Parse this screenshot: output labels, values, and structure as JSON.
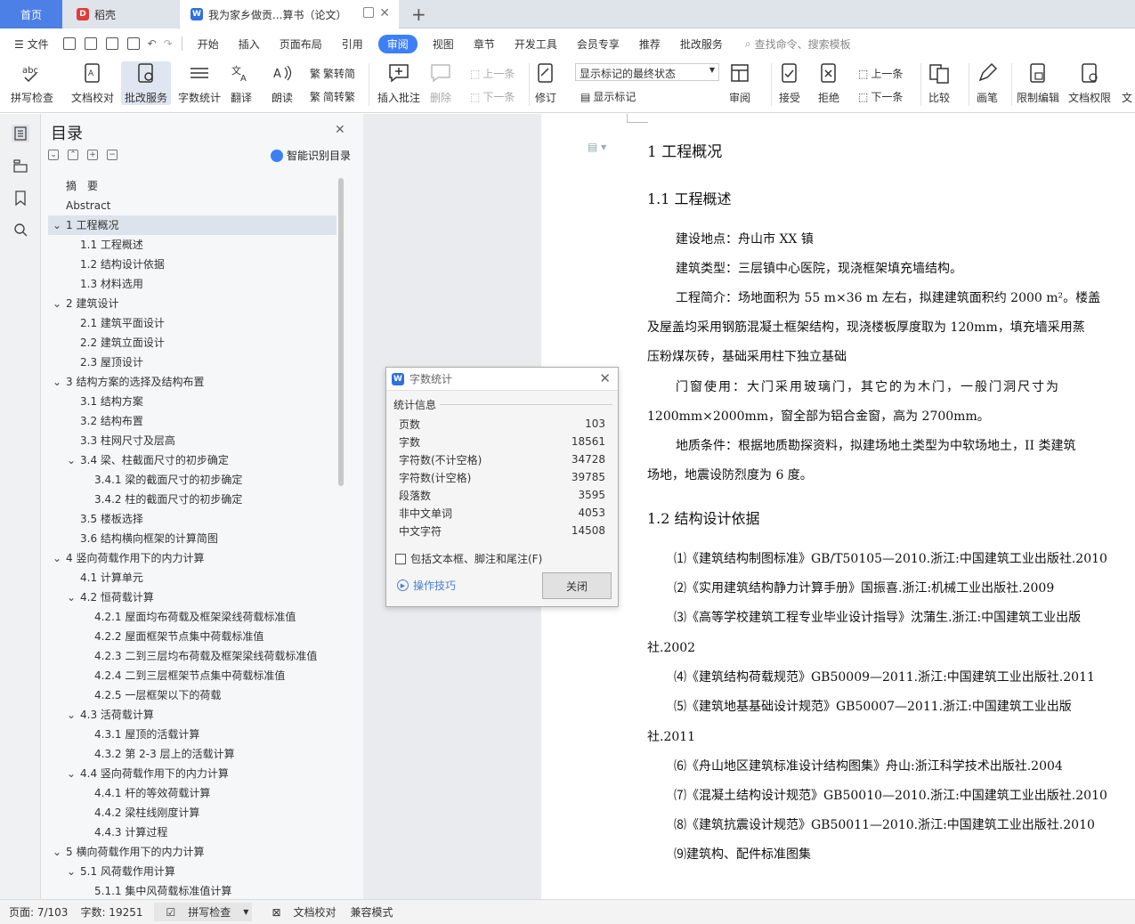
{
  "tabs": {
    "home": "首页",
    "daoke": "稻壳",
    "doc": "我为家乡做贡...算书（论文）"
  },
  "menu": {
    "file": "文件",
    "items": [
      "开始",
      "插入",
      "页面布局",
      "引用",
      "审阅",
      "视图",
      "章节",
      "开发工具",
      "会员专享",
      "推荐",
      "批改服务"
    ],
    "search": "查找命令、搜索模板"
  },
  "ribbon": {
    "spell": "拼写检查",
    "proof": "文档校对",
    "correct": "批改服务",
    "wordcount": "字数统计",
    "translate": "翻译",
    "read": "朗读",
    "trad": "繁转简",
    "simp": "简转繁",
    "insert_comment": "插入批注",
    "delete": "删除",
    "prev": "上一条",
    "next": "下一条",
    "revise": "修订",
    "markup_mode": "显示标记的最终状态",
    "show_markup": "显示标记",
    "review": "审阅",
    "accept": "接受",
    "reject": "拒绝",
    "prev2": "上一条",
    "next2": "下一条",
    "compare": "比较",
    "pen": "画笔",
    "restrict": "限制编辑",
    "rights": "文档权限",
    "more": "文"
  },
  "nav": {
    "title": "目录",
    "smart": "智能识别目录",
    "toc": [
      {
        "t": "摘　要",
        "l": 0,
        "a": ""
      },
      {
        "t": "Abstract",
        "l": 0,
        "a": ""
      },
      {
        "t": "1  工程概况",
        "l": 0,
        "a": "v"
      },
      {
        "t": "1.1 工程概述",
        "l": 1,
        "a": ""
      },
      {
        "t": "1.2 结构设计依据",
        "l": 1,
        "a": ""
      },
      {
        "t": "1.3 材料选用",
        "l": 1,
        "a": ""
      },
      {
        "t": "2  建筑设计",
        "l": 0,
        "a": "v"
      },
      {
        "t": "2.1  建筑平面设计",
        "l": 1,
        "a": ""
      },
      {
        "t": "2.2  建筑立面设计",
        "l": 1,
        "a": ""
      },
      {
        "t": "2.3  屋顶设计",
        "l": 1,
        "a": ""
      },
      {
        "t": "3  结构方案的选择及结构布置",
        "l": 0,
        "a": "v"
      },
      {
        "t": "3.1 结构方案",
        "l": 1,
        "a": ""
      },
      {
        "t": "3.2 结构布置",
        "l": 1,
        "a": ""
      },
      {
        "t": "3.3 柱网尺寸及层高",
        "l": 1,
        "a": ""
      },
      {
        "t": "3.4 梁、柱截面尺寸的初步确定",
        "l": 1,
        "a": "v"
      },
      {
        "t": "3.4.1 梁的截面尺寸的初步确定",
        "l": 2,
        "a": ""
      },
      {
        "t": "3.4.2 柱的截面尺寸的初步确定",
        "l": 2,
        "a": ""
      },
      {
        "t": "3.5 楼板选择",
        "l": 1,
        "a": ""
      },
      {
        "t": "3.6 结构横向框架的计算简图",
        "l": 1,
        "a": ""
      },
      {
        "t": "4  竖向荷载作用下的内力计算",
        "l": 0,
        "a": "v"
      },
      {
        "t": "4.1 计算单元",
        "l": 1,
        "a": ""
      },
      {
        "t": "4.2 恒荷载计算",
        "l": 1,
        "a": "v"
      },
      {
        "t": "4.2.1 屋面均布荷载及框架梁线荷载标准值",
        "l": 2,
        "a": ""
      },
      {
        "t": "4.2.2 屋面框架节点集中荷载标准值",
        "l": 2,
        "a": ""
      },
      {
        "t": "4.2.3 二到三层均布荷载及框架梁线荷载标准值",
        "l": 2,
        "a": ""
      },
      {
        "t": "4.2.4 二到三层框架节点集中荷载标准值",
        "l": 2,
        "a": ""
      },
      {
        "t": "4.2.5 一层框架以下的荷载",
        "l": 2,
        "a": ""
      },
      {
        "t": "4.3 活荷载计算",
        "l": 1,
        "a": "v"
      },
      {
        "t": "4.3.1 屋顶的活载计算",
        "l": 2,
        "a": ""
      },
      {
        "t": "4.3.2 第 2-3 层上的活载计算",
        "l": 2,
        "a": ""
      },
      {
        "t": "4.4 竖向荷载作用下的内力计算",
        "l": 1,
        "a": "v"
      },
      {
        "t": "4.4.1 杆的等效荷载计算",
        "l": 2,
        "a": ""
      },
      {
        "t": "4.4.2 梁柱线刚度计算",
        "l": 2,
        "a": ""
      },
      {
        "t": "4.4.3 计算过程",
        "l": 2,
        "a": ""
      },
      {
        "t": "5  横向荷载作用下的内力计算",
        "l": 0,
        "a": "v"
      },
      {
        "t": "5.1 风荷载作用计算",
        "l": 1,
        "a": "v"
      },
      {
        "t": "5.1.1 集中风荷载标准值计算",
        "l": 2,
        "a": ""
      }
    ]
  },
  "doc": {
    "h1": "1  工程概况",
    "h11": "1.1 工程概述",
    "l1": "建设地点：舟山市 XX 镇",
    "l2": "建筑类型：三层镇中心医院，现浇框架填充墙结构。",
    "l3": "工程简介：场地面积为 55 m×36 m 左右，拟建建筑面积约 2000 m²。楼盖",
    "l4": "及屋盖均采用钢筋混凝土框架结构，现浇楼板厚度取为 120mm，填充墙采用蒸",
    "l5": "压粉煤灰砖，基础采用柱下独立基础",
    "l6": "门窗使用：大门采用玻璃门，其它的为木门，一般门洞尺寸为",
    "l7": "1200mm×2000mm，窗全部为铝合金窗，高为 2700mm。",
    "l8": "地质条件：根据地质勘探资料，拟建场地土类型为中软场地土，II 类建筑",
    "l9": "场地，地震设防烈度为 6 度。",
    "h12": "1.2 结构设计依据",
    "r1": "⑴《建筑结构制图标准》GB/T50105—2010.浙江:中国建筑工业出版社.2010",
    "r2": "⑵《实用建筑结构静力计算手册》国振喜.浙江:机械工业出版社.2009",
    "r3": "⑶《高等学校建筑工程专业毕业设计指导》沈蒲生.浙江:中国建筑工业出版",
    "r3b": "社.2002",
    "r4": "⑷《建筑结构荷载规范》GB50009—2011.浙江:中国建筑工业出版社.2011",
    "r5": "⑸《建筑地基基础设计规范》GB50007—2011.浙江:中国建筑工业出版",
    "r5b": "社.2011",
    "r6": "⑹《舟山地区建筑标准设计结构图集》舟山:浙江科学技术出版社.2004",
    "r7": "⑺《混凝土结构设计规范》GB50010—2010.浙江:中国建筑工业出版社.2010",
    "r8": "⑻《建筑抗震设计规范》GB50011—2010.浙江:中国建筑工业出版社.2010",
    "r9": "⑼建筑构、配件标准图集"
  },
  "dialog": {
    "title": "字数统计",
    "section": "统计信息",
    "rows": [
      {
        "k": "页数",
        "v": "103"
      },
      {
        "k": "字数",
        "v": "18561"
      },
      {
        "k": "字符数(不计空格)",
        "v": "34728"
      },
      {
        "k": "字符数(计空格)",
        "v": "39785"
      },
      {
        "k": "段落数",
        "v": "3595"
      },
      {
        "k": "非中文单词",
        "v": "4053"
      },
      {
        "k": "中文字符",
        "v": "14508"
      }
    ],
    "checkbox": "包括文本框、脚注和尾注(F)",
    "tips": "操作技巧",
    "close": "关闭"
  },
  "status": {
    "page": "页面: 7/103",
    "words": "字数: 19251",
    "spell": "拼写检查",
    "proof": "文档校对",
    "compat": "兼容模式"
  },
  "colors": {
    "accent": "#3d7ff6",
    "home_tab": "#4d80e6",
    "wps_red": "#e03b3b",
    "wps_blue": "#2f6fe0"
  }
}
